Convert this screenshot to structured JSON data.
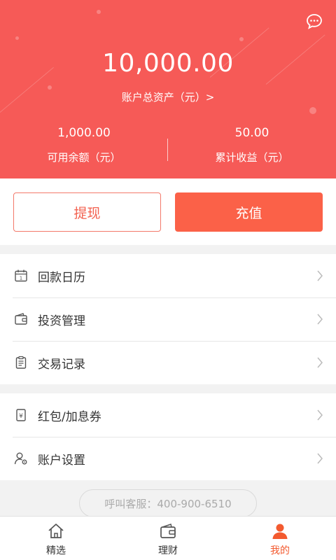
{
  "header": {
    "total_assets": "10,000.00",
    "total_assets_label": "账户总资产（元）>",
    "available_balance": "1,000.00",
    "available_balance_label": "可用余额（元）",
    "cumulative_income": "50.00",
    "cumulative_income_label": "累计收益（元）"
  },
  "actions": {
    "withdraw_label": "提现",
    "recharge_label": "充值"
  },
  "menu_group_1": [
    {
      "label": "回款日历",
      "icon": "calendar-icon"
    },
    {
      "label": "投资管理",
      "icon": "wallet-icon"
    },
    {
      "label": "交易记录",
      "icon": "clipboard-icon"
    }
  ],
  "menu_group_2": [
    {
      "label": "红包/加息券",
      "icon": "coupon-icon"
    },
    {
      "label": "账户设置",
      "icon": "user-settings-icon"
    }
  ],
  "hotline": "呼叫客服：400-900-6510",
  "tabs": [
    {
      "label": "精选",
      "icon": "home-icon",
      "active": false
    },
    {
      "label": "理财",
      "icon": "wallet-icon",
      "active": false
    },
    {
      "label": "我的",
      "icon": "person-icon",
      "active": true
    }
  ],
  "colors": {
    "brand": "#f65a57",
    "accent": "#fb6148",
    "active_tab": "#f35a2f"
  }
}
